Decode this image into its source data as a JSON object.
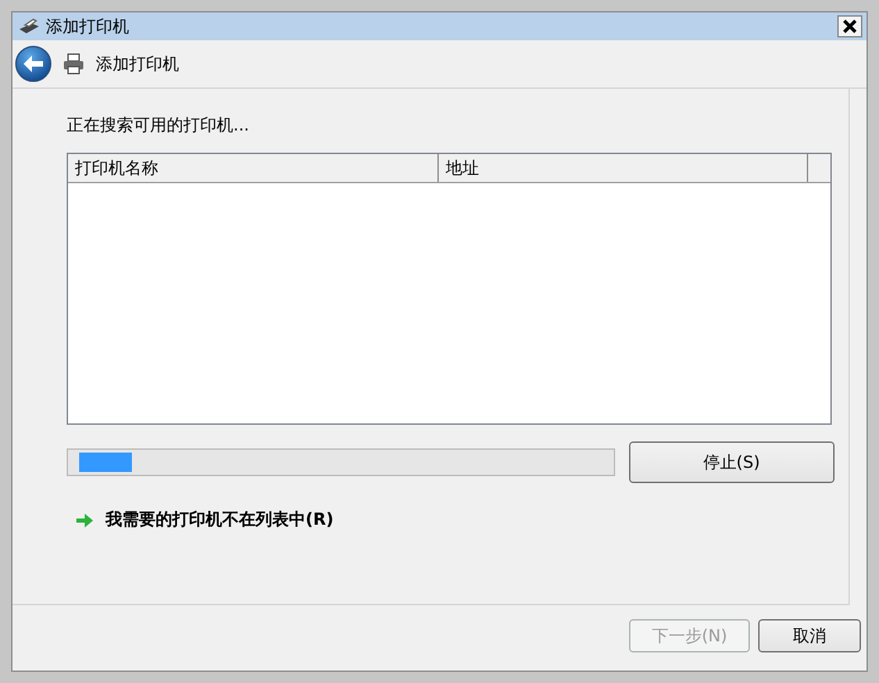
{
  "window": {
    "title": "添加打印机"
  },
  "header": {
    "title": "添加打印机"
  },
  "status_text": "正在搜索可用的打印机...",
  "table": {
    "columns": [
      {
        "label": "打印机名称"
      },
      {
        "label": "地址"
      }
    ]
  },
  "progress": {
    "level": 0.1
  },
  "stop_button": {
    "label": "停止(S)"
  },
  "link": {
    "label": "我需要的打印机不在列表中(R)"
  },
  "buttons": [
    {
      "label": "下一步(N)",
      "disabled": true
    },
    {
      "label": "取消",
      "disabled": false
    }
  ]
}
